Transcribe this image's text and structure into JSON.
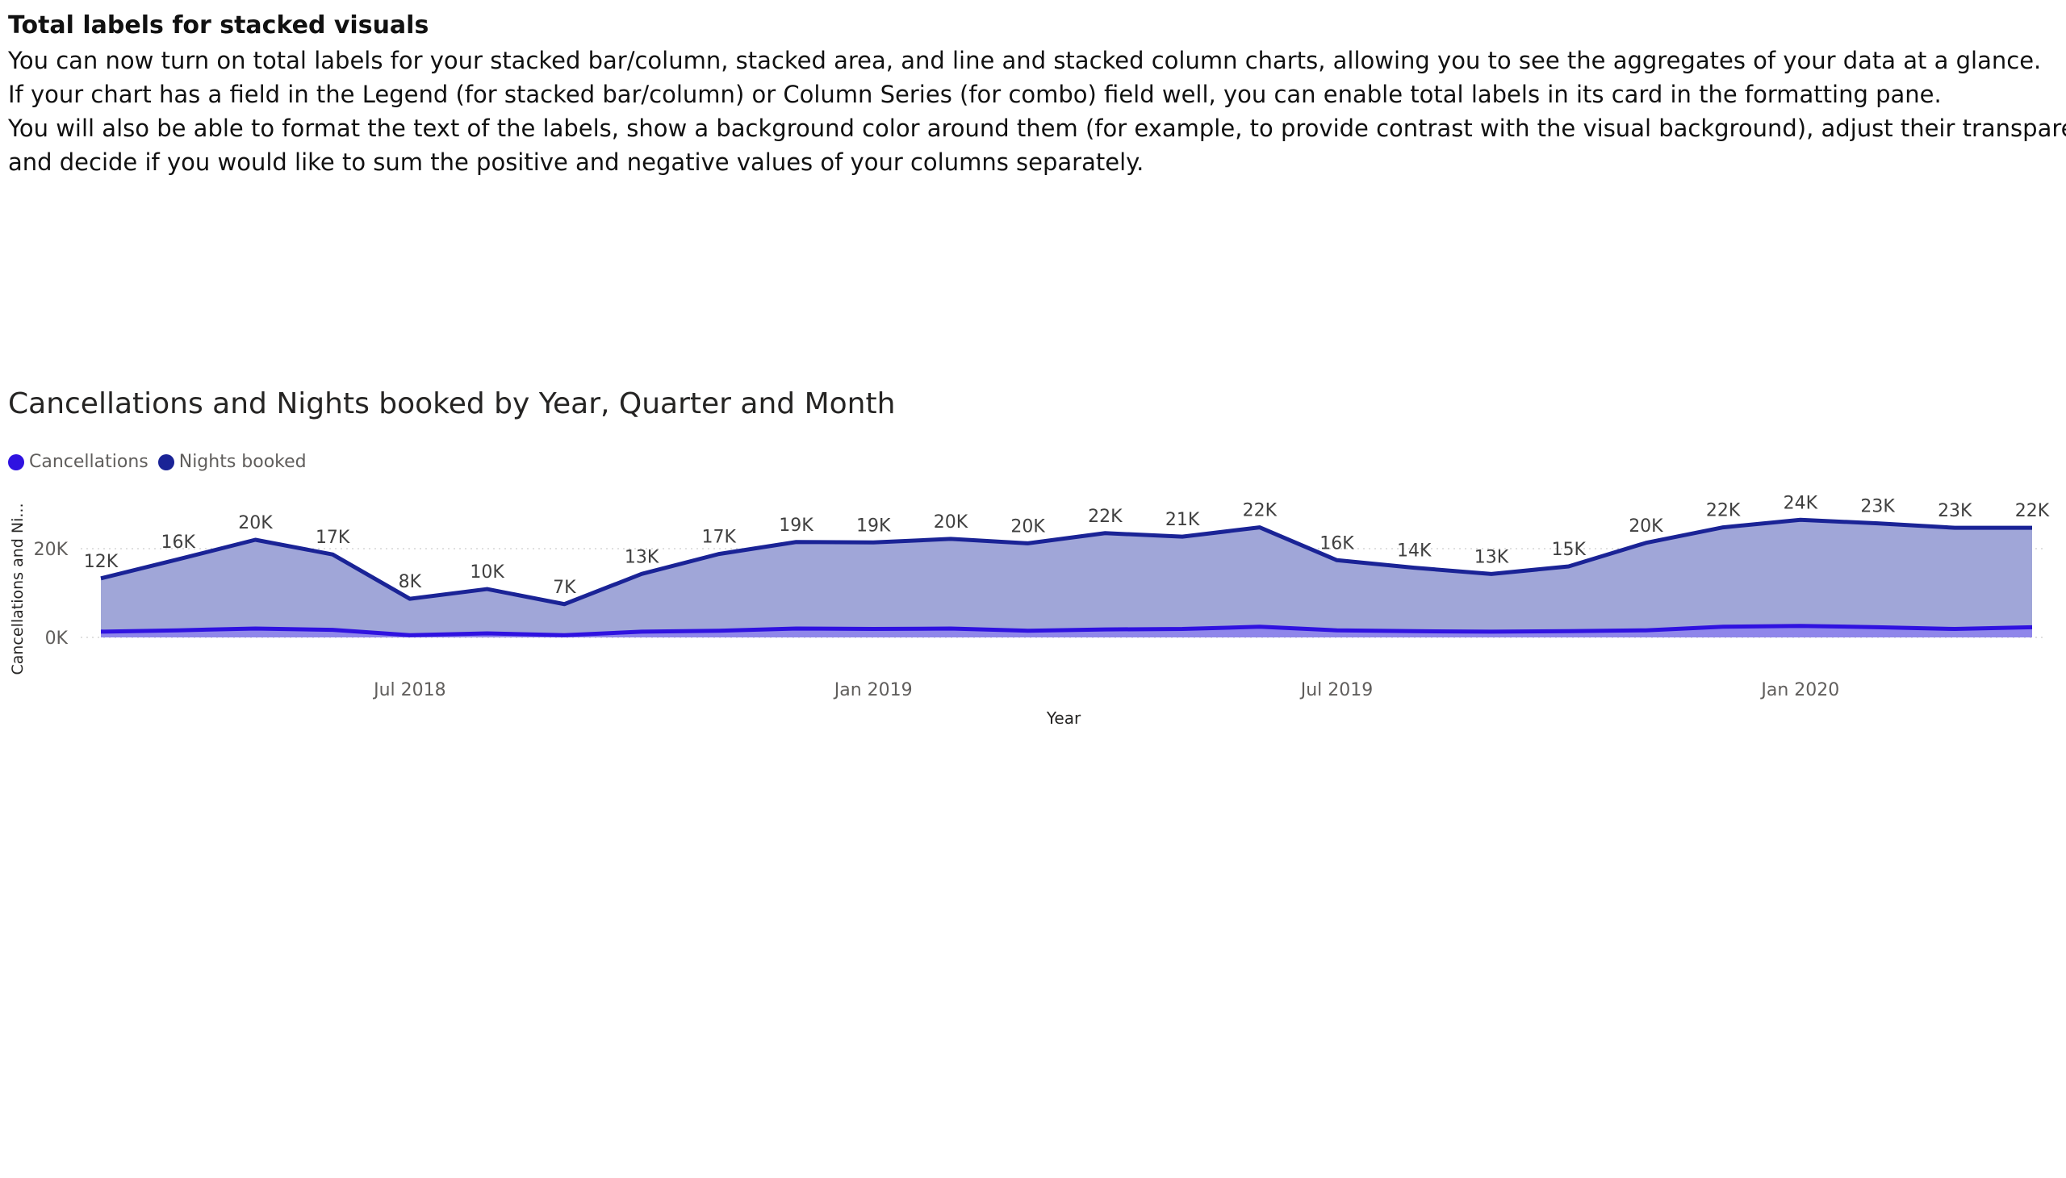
{
  "article": {
    "heading": "Total labels for stacked visuals",
    "paragraphs": [
      "You can now turn on total labels for your stacked bar/column, stacked area, and line and stacked column charts, allowing you to see the aggregates of your data at a glance.",
      "If your chart has a field in the Legend (for stacked bar/column) or Column Series (for combo) field well, you can enable total labels in its card in the formatting pane.",
      "You will also be able to format the text of the labels, show a background color around them (for example, to provide contrast with the visual background), adjust their transparency,",
      "and decide if you would like to sum the positive and negative values of your columns separately."
    ]
  },
  "chart_data": {
    "type": "area",
    "title": "Cancellations and Nights booked by Year, Quarter and Month",
    "xlabel": "Year",
    "ylabel": "Cancellations and Ni...",
    "x_tick_labels": [
      "Jul 2018",
      "Jan 2019",
      "Jul 2019",
      "Jan 2020"
    ],
    "x_tick_months": [
      "2018-07",
      "2019-01",
      "2019-07",
      "2020-01"
    ],
    "y_ticks": [
      {
        "value": 0,
        "label": "0K"
      },
      {
        "value": 20000,
        "label": "20K"
      }
    ],
    "ylim": [
      0,
      30000
    ],
    "grid": true,
    "legend_position": "top-left",
    "x": [
      "2018-03",
      "2018-04",
      "2018-05",
      "2018-06",
      "2018-07",
      "2018-08",
      "2018-09",
      "2018-10",
      "2018-11",
      "2018-12",
      "2019-01",
      "2019-02",
      "2019-03",
      "2019-04",
      "2019-05",
      "2019-06",
      "2019-07",
      "2019-08",
      "2019-09",
      "2019-10",
      "2019-11",
      "2019-12",
      "2020-01",
      "2020-02",
      "2020-03",
      "2020-04"
    ],
    "total_labels": [
      "12K",
      "16K",
      "20K",
      "17K",
      "8K",
      "10K",
      "7K",
      "13K",
      "17K",
      "19K",
      "19K",
      "20K",
      "20K",
      "22K",
      "21K",
      "22K",
      "16K",
      "14K",
      "13K",
      "15K",
      "20K",
      "22K",
      "24K",
      "23K",
      "23K",
      "22K"
    ],
    "series": [
      {
        "name": "Cancellations",
        "color": "#2f12e0",
        "values": [
          1300,
          1600,
          2000,
          1700,
          500,
          900,
          500,
          1300,
          1500,
          2000,
          1900,
          2000,
          1500,
          1800,
          1900,
          2400,
          1600,
          1400,
          1300,
          1400,
          1600,
          2400,
          2600,
          2300,
          1900,
          2300
        ]
      },
      {
        "name": "Nights booked",
        "color": "#1a2396",
        "values": [
          12000,
          16000,
          20000,
          17000,
          8200,
          10000,
          7000,
          13000,
          17300,
          19500,
          19500,
          20200,
          19700,
          21700,
          20800,
          22400,
          15800,
          14300,
          13000,
          14600,
          19700,
          22400,
          23900,
          23400,
          22800,
          22400
        ]
      }
    ],
    "colors": {
      "area_fill": "#a0a6d8",
      "gridline": "#d6d6d6",
      "tick_text": "#605e5c",
      "label_text": "#404040"
    }
  }
}
